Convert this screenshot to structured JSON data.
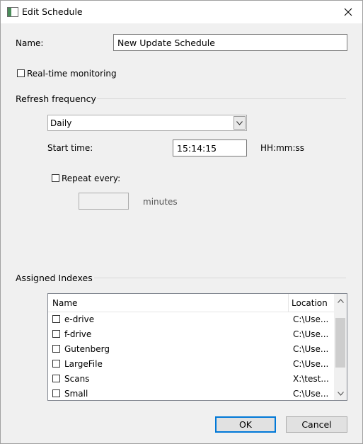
{
  "window": {
    "title": "Edit Schedule",
    "icon": "window-app-icon",
    "close_icon": "close-icon"
  },
  "form": {
    "name_label": "Name:",
    "name_value": "New Update Schedule",
    "realtime_label": "Real-time monitoring",
    "realtime_checked": false
  },
  "refresh": {
    "group_label": "Refresh frequency",
    "frequency_selected": "Daily",
    "start_time_label": "Start time:",
    "start_time_value": "15:14:15",
    "time_format": "HH:mm:ss",
    "repeat_label": "Repeat every:",
    "repeat_checked": false,
    "repeat_value": "",
    "minutes_label": "minutes"
  },
  "indexes": {
    "group_label": "Assigned Indexes",
    "columns": {
      "name": "Name",
      "location": "Location"
    },
    "rows": [
      {
        "name": "e-drive",
        "location": "C:\\Use...",
        "checked": false
      },
      {
        "name": "f-drive",
        "location": "C:\\Use...",
        "checked": false
      },
      {
        "name": "Gutenberg",
        "location": "C:\\Use...",
        "checked": false
      },
      {
        "name": "LargeFile",
        "location": "C:\\Use...",
        "checked": false
      },
      {
        "name": "Scans",
        "location": "X:\\test...",
        "checked": false
      },
      {
        "name": "Small",
        "location": "C:\\Use...",
        "checked": false
      }
    ]
  },
  "buttons": {
    "ok": "OK",
    "cancel": "Cancel"
  },
  "colors": {
    "accent": "#0078d7",
    "background": "#f0f0f0",
    "titlebar": "#ffffff"
  }
}
